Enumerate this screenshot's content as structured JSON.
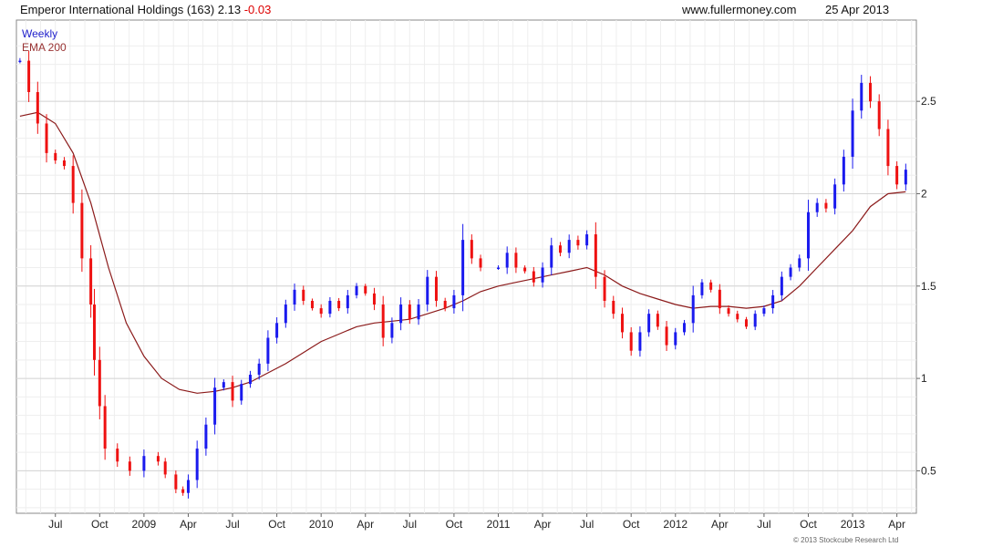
{
  "header": {
    "title": "Emperor International Holdings (163) 2.13",
    "change": "-0.03",
    "site": "www.fullermoney.com",
    "date": "25 Apr 2013"
  },
  "legend": {
    "weekly": "Weekly",
    "ema": "EMA 200"
  },
  "credit": "© 2013 Stockcube Research Ltd",
  "colors": {
    "up": "#1a1aee",
    "down": "#ee1111",
    "ema": "#8b1a1a",
    "grid": "#d4d4d4"
  },
  "chart_data": {
    "type": "line",
    "title": "Emperor International Holdings (163) 2.13 -0.03",
    "ylim": [
      0.27,
      2.94
    ],
    "grid": true,
    "y_ticks": [
      "0.5",
      "1",
      "1.5",
      "2",
      "2.5"
    ],
    "x_ticks": [
      "Jul",
      "Oct",
      "2009",
      "Apr",
      "Jul",
      "Oct",
      "2010",
      "Apr",
      "Jul",
      "Oct",
      "2011",
      "Apr",
      "Jul",
      "Oct",
      "2012",
      "Apr",
      "Jul",
      "Oct",
      "2013",
      "Apr"
    ],
    "x_tick_positions": [
      2008.5,
      2008.75,
      2009.0,
      2009.25,
      2009.5,
      2009.75,
      2010.0,
      2010.25,
      2010.5,
      2010.75,
      2011.0,
      2011.25,
      2011.5,
      2011.75,
      2012.0,
      2012.25,
      2012.5,
      2012.75,
      2013.0,
      2013.25
    ],
    "series": [
      {
        "name": "Weekly",
        "points": [
          [
            2008.3,
            2.72
          ],
          [
            2008.35,
            2.55
          ],
          [
            2008.4,
            2.38
          ],
          [
            2008.45,
            2.22
          ],
          [
            2008.5,
            2.18
          ],
          [
            2008.55,
            2.15
          ],
          [
            2008.6,
            1.95
          ],
          [
            2008.65,
            1.65
          ],
          [
            2008.7,
            1.4
          ],
          [
            2008.72,
            1.1
          ],
          [
            2008.75,
            0.85
          ],
          [
            2008.78,
            0.62
          ],
          [
            2008.85,
            0.55
          ],
          [
            2008.92,
            0.5
          ],
          [
            2009.0,
            0.58
          ],
          [
            2009.08,
            0.55
          ],
          [
            2009.12,
            0.48
          ],
          [
            2009.18,
            0.4
          ],
          [
            2009.22,
            0.38
          ],
          [
            2009.25,
            0.45
          ],
          [
            2009.3,
            0.62
          ],
          [
            2009.35,
            0.75
          ],
          [
            2009.4,
            0.95
          ],
          [
            2009.45,
            0.98
          ],
          [
            2009.5,
            0.88
          ],
          [
            2009.55,
            0.97
          ],
          [
            2009.6,
            1.02
          ],
          [
            2009.65,
            1.08
          ],
          [
            2009.7,
            1.22
          ],
          [
            2009.75,
            1.3
          ],
          [
            2009.8,
            1.4
          ],
          [
            2009.85,
            1.48
          ],
          [
            2009.9,
            1.42
          ],
          [
            2009.95,
            1.38
          ],
          [
            2010.0,
            1.35
          ],
          [
            2010.05,
            1.42
          ],
          [
            2010.1,
            1.38
          ],
          [
            2010.15,
            1.45
          ],
          [
            2010.2,
            1.5
          ],
          [
            2010.25,
            1.46
          ],
          [
            2010.3,
            1.4
          ],
          [
            2010.35,
            1.22
          ],
          [
            2010.4,
            1.3
          ],
          [
            2010.45,
            1.4
          ],
          [
            2010.5,
            1.32
          ],
          [
            2010.55,
            1.4
          ],
          [
            2010.6,
            1.55
          ],
          [
            2010.65,
            1.42
          ],
          [
            2010.7,
            1.38
          ],
          [
            2010.75,
            1.45
          ],
          [
            2010.8,
            1.75
          ],
          [
            2010.85,
            1.65
          ],
          [
            2010.9,
            1.6
          ],
          [
            2011.0,
            1.6
          ],
          [
            2011.05,
            1.68
          ],
          [
            2011.1,
            1.6
          ],
          [
            2011.15,
            1.58
          ],
          [
            2011.2,
            1.52
          ],
          [
            2011.25,
            1.6
          ],
          [
            2011.3,
            1.72
          ],
          [
            2011.35,
            1.68
          ],
          [
            2011.4,
            1.75
          ],
          [
            2011.45,
            1.72
          ],
          [
            2011.5,
            1.78
          ],
          [
            2011.55,
            1.55
          ],
          [
            2011.6,
            1.42
          ],
          [
            2011.65,
            1.35
          ],
          [
            2011.7,
            1.25
          ],
          [
            2011.75,
            1.15
          ],
          [
            2011.8,
            1.25
          ],
          [
            2011.85,
            1.35
          ],
          [
            2011.9,
            1.28
          ],
          [
            2011.95,
            1.18
          ],
          [
            2012.0,
            1.25
          ],
          [
            2012.05,
            1.3
          ],
          [
            2012.1,
            1.45
          ],
          [
            2012.15,
            1.52
          ],
          [
            2012.2,
            1.48
          ],
          [
            2012.25,
            1.38
          ],
          [
            2012.3,
            1.35
          ],
          [
            2012.35,
            1.32
          ],
          [
            2012.4,
            1.28
          ],
          [
            2012.45,
            1.35
          ],
          [
            2012.5,
            1.38
          ],
          [
            2012.55,
            1.45
          ],
          [
            2012.6,
            1.55
          ],
          [
            2012.65,
            1.6
          ],
          [
            2012.7,
            1.65
          ],
          [
            2012.75,
            1.9
          ],
          [
            2012.8,
            1.95
          ],
          [
            2012.85,
            1.92
          ],
          [
            2012.9,
            2.05
          ],
          [
            2012.95,
            2.2
          ],
          [
            2013.0,
            2.45
          ],
          [
            2013.05,
            2.6
          ],
          [
            2013.1,
            2.5
          ],
          [
            2013.15,
            2.35
          ],
          [
            2013.2,
            2.15
          ],
          [
            2013.25,
            2.05
          ],
          [
            2013.3,
            2.13
          ]
        ]
      },
      {
        "name": "EMA 200",
        "points": [
          [
            2008.3,
            2.42
          ],
          [
            2008.4,
            2.44
          ],
          [
            2008.5,
            2.38
          ],
          [
            2008.6,
            2.22
          ],
          [
            2008.7,
            1.95
          ],
          [
            2008.8,
            1.6
          ],
          [
            2008.9,
            1.3
          ],
          [
            2009.0,
            1.12
          ],
          [
            2009.1,
            1.0
          ],
          [
            2009.2,
            0.94
          ],
          [
            2009.3,
            0.92
          ],
          [
            2009.4,
            0.93
          ],
          [
            2009.5,
            0.95
          ],
          [
            2009.6,
            0.98
          ],
          [
            2009.7,
            1.03
          ],
          [
            2009.8,
            1.08
          ],
          [
            2009.9,
            1.14
          ],
          [
            2010.0,
            1.2
          ],
          [
            2010.1,
            1.24
          ],
          [
            2010.2,
            1.28
          ],
          [
            2010.3,
            1.3
          ],
          [
            2010.4,
            1.31
          ],
          [
            2010.5,
            1.32
          ],
          [
            2010.6,
            1.35
          ],
          [
            2010.7,
            1.38
          ],
          [
            2010.8,
            1.42
          ],
          [
            2010.9,
            1.47
          ],
          [
            2011.0,
            1.5
          ],
          [
            2011.1,
            1.52
          ],
          [
            2011.2,
            1.54
          ],
          [
            2011.3,
            1.56
          ],
          [
            2011.4,
            1.58
          ],
          [
            2011.5,
            1.6
          ],
          [
            2011.6,
            1.56
          ],
          [
            2011.7,
            1.5
          ],
          [
            2011.8,
            1.46
          ],
          [
            2011.9,
            1.43
          ],
          [
            2012.0,
            1.4
          ],
          [
            2012.1,
            1.38
          ],
          [
            2012.2,
            1.39
          ],
          [
            2012.3,
            1.39
          ],
          [
            2012.4,
            1.38
          ],
          [
            2012.5,
            1.39
          ],
          [
            2012.6,
            1.42
          ],
          [
            2012.7,
            1.5
          ],
          [
            2012.8,
            1.6
          ],
          [
            2012.9,
            1.7
          ],
          [
            2013.0,
            1.8
          ],
          [
            2013.1,
            1.93
          ],
          [
            2013.2,
            2.0
          ],
          [
            2013.3,
            2.01
          ]
        ]
      }
    ]
  }
}
